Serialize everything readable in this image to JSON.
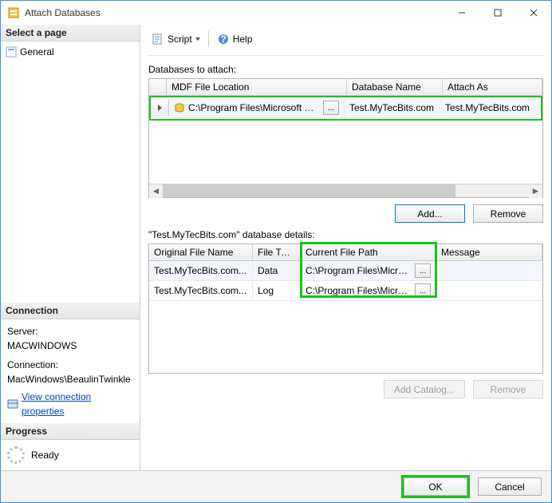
{
  "window": {
    "title": "Attach Databases"
  },
  "winbuttons": {
    "min": "minimize",
    "max": "maximize",
    "close": "close"
  },
  "left": {
    "select_page": "Select a page",
    "general": "General",
    "connection": "Connection",
    "server_label": "Server:",
    "server_value": "MACWINDOWS",
    "conn_label": "Connection:",
    "conn_value": "MacWindows\\BeaulinTwinkle",
    "view_conn": "View connection properties",
    "progress": "Progress",
    "ready": "Ready"
  },
  "toolbar": {
    "script": "Script",
    "help": "Help"
  },
  "main": {
    "databases_to_attach": "Databases to attach:",
    "grid1": {
      "headers": {
        "mdf": "MDF File Location",
        "dbname": "Database Name",
        "attachas": "Attach As"
      },
      "row": {
        "mdf": "C:\\Program Files\\Microsoft SQL Ser...",
        "dbname": "Test.MyTecBits.com",
        "attachas": "Test.MyTecBits.com"
      }
    },
    "add": "Add...",
    "remove": "Remove",
    "details_title": "\"Test.MyTecBits.com\" database details:",
    "grid2": {
      "headers": {
        "ofn": "Original File Name",
        "ft": "File Type",
        "cfp": "Current File Path",
        "msg": "Message"
      },
      "rows": [
        {
          "ofn": "Test.MyTecBits.com...",
          "ft": "Data",
          "cfp": "C:\\Program Files\\Microso..."
        },
        {
          "ofn": "Test.MyTecBits.com...",
          "ft": "Log",
          "cfp": "C:\\Program Files\\Microso..."
        }
      ]
    },
    "add_catalog": "Add Catalog...",
    "remove2": "Remove"
  },
  "footer": {
    "ok": "OK",
    "cancel": "Cancel"
  }
}
